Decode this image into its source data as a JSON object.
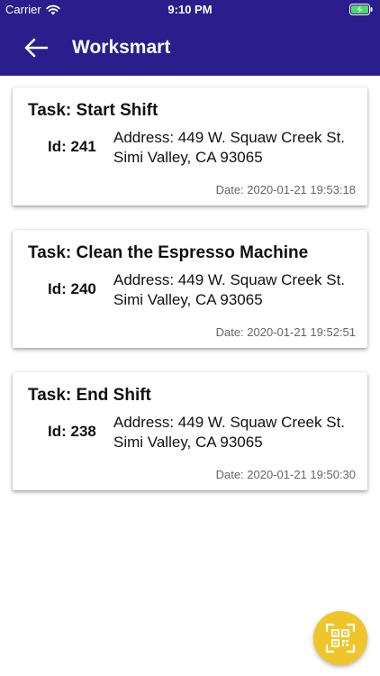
{
  "status_bar": {
    "carrier": "Carrier",
    "time": "9:10 PM"
  },
  "app_bar": {
    "title": "Worksmart",
    "back_icon": "arrow-left-icon",
    "background_color": "#2b1d8c"
  },
  "tasks": [
    {
      "title": "Task: Start Shift",
      "id_label": "Id: 241",
      "address": "Address: 449 W. Squaw Creek St. Simi Valley, CA 93065",
      "date": "Date: 2020-01-21 19:53:18"
    },
    {
      "title": "Task: Clean the Espresso Machine",
      "id_label": "Id: 240",
      "address": "Address: 449 W. Squaw Creek St. Simi Valley, CA 93065",
      "date": "Date: 2020-01-21 19:52:51"
    },
    {
      "title": "Task: End Shift",
      "id_label": "Id: 238",
      "address": "Address: 449 W. Squaw Creek St. Simi Valley, CA 93065",
      "date": "Date: 2020-01-21 19:50:30"
    }
  ],
  "fab": {
    "icon": "qr-scan-icon",
    "color": "#f0c52c"
  }
}
